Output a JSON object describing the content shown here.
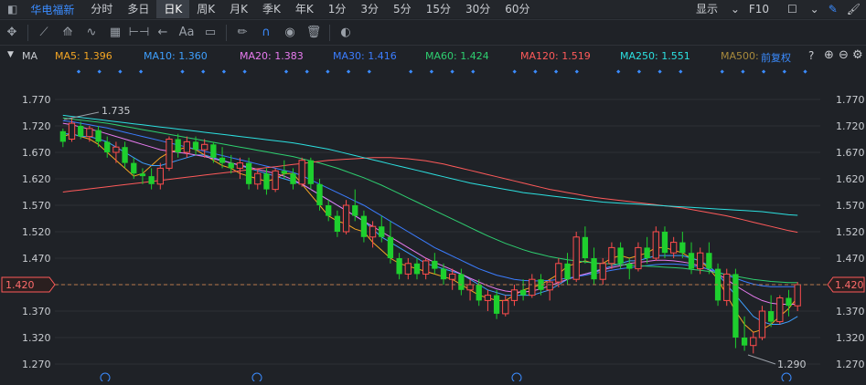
{
  "topbar": {
    "stock_name": "华电福新",
    "tabs": [
      {
        "label": "分时"
      },
      {
        "label": "多日"
      },
      {
        "label": "日K"
      },
      {
        "label": "周K"
      },
      {
        "label": "月K"
      },
      {
        "label": "季K"
      },
      {
        "label": "年K"
      },
      {
        "label": "1分"
      },
      {
        "label": "3分"
      },
      {
        "label": "5分"
      },
      {
        "label": "15分"
      },
      {
        "label": "30分"
      },
      {
        "label": "60分"
      }
    ],
    "active_tab": "日K",
    "display_label": "显示",
    "f10_label": "F10"
  },
  "toolbar": {
    "tools": [
      "crosshair-icon",
      "line-icon",
      "pencil-line-icon",
      "wave-icon",
      "grid-icon",
      "measure-icon",
      "arrow-left-icon",
      "text-icon",
      "comment-icon",
      "eraser-icon",
      "magnet-icon",
      "eye-icon",
      "trash-icon",
      "toggle-icon"
    ],
    "text_tool_label": "Aa"
  },
  "ma_bar": {
    "label": "MA",
    "items": [
      {
        "text": "MA5: 1.396",
        "color": "#f5a623"
      },
      {
        "text": "MA10: 1.360",
        "color": "#3ea0ff"
      },
      {
        "text": "MA20: 1.383",
        "color": "#e87bf0"
      },
      {
        "text": "MA30: 1.416",
        "color": "#3b7dff"
      },
      {
        "text": "MA60: 1.424",
        "color": "#2ecf70"
      },
      {
        "text": "MA120: 1.519",
        "color": "#ff5a5a"
      },
      {
        "text": "MA250: 1.551",
        "color": "#2ce0e0"
      },
      {
        "text": "MA500: ",
        "color": "#a88a3c"
      }
    ],
    "adjust_label": "前复权"
  },
  "chart_data": {
    "type": "candlestick",
    "y_ticks": [
      "1.770",
      "1.720",
      "1.670",
      "1.620",
      "1.570",
      "1.520",
      "1.470",
      "1.420",
      "1.370",
      "1.320",
      "1.270"
    ],
    "ylim": [
      1.255,
      1.795
    ],
    "current_price": "1.420",
    "high_label": "1.735",
    "low_label": "1.290",
    "colors": {
      "up": "#ff4d4d",
      "down": "#1ecf2e",
      "grid": "#2c3036",
      "dashed": "#b8794d"
    },
    "ohlc": [
      [
        1.71,
        1.715,
        1.68,
        1.69
      ],
      [
        1.695,
        1.735,
        1.69,
        1.725
      ],
      [
        1.72,
        1.728,
        1.695,
        1.7
      ],
      [
        1.7,
        1.72,
        1.69,
        1.715
      ],
      [
        1.712,
        1.72,
        1.68,
        1.69
      ],
      [
        1.69,
        1.7,
        1.66,
        1.67
      ],
      [
        1.67,
        1.69,
        1.65,
        1.68
      ],
      [
        1.68,
        1.69,
        1.64,
        1.65
      ],
      [
        1.65,
        1.66,
        1.62,
        1.63
      ],
      [
        1.63,
        1.64,
        1.61,
        1.625
      ],
      [
        1.625,
        1.64,
        1.6,
        1.61
      ],
      [
        1.61,
        1.65,
        1.6,
        1.64
      ],
      [
        1.64,
        1.7,
        1.635,
        1.695
      ],
      [
        1.695,
        1.705,
        1.66,
        1.67
      ],
      [
        1.67,
        1.7,
        1.66,
        1.69
      ],
      [
        1.69,
        1.7,
        1.665,
        1.675
      ],
      [
        1.675,
        1.695,
        1.66,
        1.685
      ],
      [
        1.685,
        1.69,
        1.65,
        1.66
      ],
      [
        1.66,
        1.68,
        1.64,
        1.65
      ],
      [
        1.65,
        1.665,
        1.63,
        1.64
      ],
      [
        1.64,
        1.66,
        1.62,
        1.65
      ],
      [
        1.65,
        1.66,
        1.6,
        1.61
      ],
      [
        1.61,
        1.64,
        1.6,
        1.63
      ],
      [
        1.63,
        1.64,
        1.59,
        1.6
      ],
      [
        1.6,
        1.64,
        1.595,
        1.635
      ],
      [
        1.635,
        1.655,
        1.62,
        1.63
      ],
      [
        1.63,
        1.64,
        1.6,
        1.61
      ],
      [
        1.61,
        1.66,
        1.605,
        1.655
      ],
      [
        1.655,
        1.66,
        1.6,
        1.61
      ],
      [
        1.61,
        1.62,
        1.56,
        1.57
      ],
      [
        1.57,
        1.58,
        1.54,
        1.55
      ],
      [
        1.55,
        1.56,
        1.51,
        1.52
      ],
      [
        1.52,
        1.58,
        1.515,
        1.57
      ],
      [
        1.57,
        1.6,
        1.54,
        1.55
      ],
      [
        1.55,
        1.56,
        1.5,
        1.51
      ],
      [
        1.51,
        1.54,
        1.49,
        1.53
      ],
      [
        1.53,
        1.55,
        1.5,
        1.51
      ],
      [
        1.51,
        1.54,
        1.46,
        1.47
      ],
      [
        1.47,
        1.48,
        1.43,
        1.44
      ],
      [
        1.44,
        1.47,
        1.43,
        1.46
      ],
      [
        1.46,
        1.47,
        1.43,
        1.44
      ],
      [
        1.44,
        1.47,
        1.43,
        1.465
      ],
      [
        1.465,
        1.48,
        1.44,
        1.45
      ],
      [
        1.45,
        1.46,
        1.42,
        1.43
      ],
      [
        1.43,
        1.45,
        1.41,
        1.44
      ],
      [
        1.44,
        1.45,
        1.4,
        1.41
      ],
      [
        1.41,
        1.43,
        1.39,
        1.42
      ],
      [
        1.42,
        1.43,
        1.38,
        1.39
      ],
      [
        1.39,
        1.41,
        1.37,
        1.4
      ],
      [
        1.4,
        1.41,
        1.355,
        1.365
      ],
      [
        1.365,
        1.4,
        1.36,
        1.39
      ],
      [
        1.39,
        1.42,
        1.38,
        1.41
      ],
      [
        1.41,
        1.43,
        1.39,
        1.4
      ],
      [
        1.4,
        1.44,
        1.395,
        1.43
      ],
      [
        1.43,
        1.44,
        1.4,
        1.41
      ],
      [
        1.41,
        1.43,
        1.39,
        1.425
      ],
      [
        1.425,
        1.47,
        1.415,
        1.46
      ],
      [
        1.46,
        1.48,
        1.42,
        1.43
      ],
      [
        1.43,
        1.52,
        1.425,
        1.51
      ],
      [
        1.51,
        1.53,
        1.46,
        1.47
      ],
      [
        1.47,
        1.49,
        1.42,
        1.43
      ],
      [
        1.43,
        1.47,
        1.42,
        1.46
      ],
      [
        1.46,
        1.5,
        1.45,
        1.49
      ],
      [
        1.49,
        1.5,
        1.45,
        1.46
      ],
      [
        1.46,
        1.47,
        1.43,
        1.45
      ],
      [
        1.45,
        1.5,
        1.445,
        1.49
      ],
      [
        1.49,
        1.51,
        1.46,
        1.47
      ],
      [
        1.47,
        1.53,
        1.465,
        1.52
      ],
      [
        1.52,
        1.53,
        1.47,
        1.48
      ],
      [
        1.48,
        1.51,
        1.47,
        1.5
      ],
      [
        1.5,
        1.52,
        1.47,
        1.48
      ],
      [
        1.48,
        1.5,
        1.44,
        1.45
      ],
      [
        1.45,
        1.49,
        1.44,
        1.48
      ],
      [
        1.48,
        1.5,
        1.44,
        1.45
      ],
      [
        1.45,
        1.46,
        1.38,
        1.39
      ],
      [
        1.39,
        1.45,
        1.38,
        1.44
      ],
      [
        1.44,
        1.45,
        1.3,
        1.32
      ],
      [
        1.32,
        1.36,
        1.295,
        1.305
      ],
      [
        1.305,
        1.33,
        1.29,
        1.32
      ],
      [
        1.32,
        1.38,
        1.315,
        1.37
      ],
      [
        1.37,
        1.4,
        1.34,
        1.35
      ],
      [
        1.35,
        1.4,
        1.345,
        1.395
      ],
      [
        1.395,
        1.41,
        1.36,
        1.38
      ],
      [
        1.38,
        1.425,
        1.37,
        1.42
      ]
    ],
    "ma_series": [
      {
        "name": "MA5",
        "color": "#f5a623",
        "values": [
          1.7,
          1.705,
          1.7,
          1.695,
          1.685,
          1.67,
          1.655,
          1.64,
          1.625,
          1.63,
          1.645,
          1.66,
          1.67,
          1.675,
          1.68,
          1.675,
          1.665,
          1.655,
          1.645,
          1.64,
          1.63,
          1.625,
          1.62,
          1.615,
          1.62,
          1.63,
          1.63,
          1.61,
          1.59,
          1.57,
          1.55,
          1.54,
          1.535,
          1.525,
          1.52,
          1.5,
          1.485,
          1.47,
          1.46,
          1.455,
          1.45,
          1.445,
          1.44,
          1.435,
          1.43,
          1.42,
          1.41,
          1.4,
          1.395,
          1.39,
          1.39,
          1.4,
          1.41,
          1.415,
          1.42,
          1.43,
          1.44,
          1.455,
          1.46,
          1.465,
          1.46,
          1.46,
          1.47,
          1.475,
          1.47,
          1.475,
          1.48,
          1.49,
          1.49,
          1.485,
          1.48,
          1.47,
          1.465,
          1.45,
          1.43,
          1.4,
          1.37,
          1.345,
          1.33,
          1.335,
          1.345,
          1.36,
          1.375,
          1.396
        ]
      },
      {
        "name": "MA10",
        "color": "#3ea0ff",
        "values": [
          1.705,
          1.705,
          1.7,
          1.7,
          1.695,
          1.69,
          1.68,
          1.67,
          1.66,
          1.65,
          1.645,
          1.645,
          1.65,
          1.655,
          1.66,
          1.665,
          1.665,
          1.66,
          1.655,
          1.65,
          1.645,
          1.64,
          1.635,
          1.63,
          1.625,
          1.62,
          1.615,
          1.61,
          1.6,
          1.59,
          1.58,
          1.57,
          1.56,
          1.55,
          1.54,
          1.525,
          1.51,
          1.5,
          1.49,
          1.48,
          1.47,
          1.46,
          1.455,
          1.45,
          1.445,
          1.44,
          1.43,
          1.42,
          1.41,
          1.405,
          1.4,
          1.4,
          1.4,
          1.4,
          1.405,
          1.41,
          1.42,
          1.43,
          1.435,
          1.44,
          1.445,
          1.45,
          1.455,
          1.46,
          1.465,
          1.465,
          1.47,
          1.475,
          1.475,
          1.475,
          1.475,
          1.47,
          1.465,
          1.455,
          1.44,
          1.42,
          1.4,
          1.38,
          1.36,
          1.35,
          1.345,
          1.345,
          1.35,
          1.36
        ]
      },
      {
        "name": "MA20",
        "color": "#e87bf0",
        "values": [
          1.725,
          1.722,
          1.718,
          1.714,
          1.71,
          1.705,
          1.7,
          1.695,
          1.69,
          1.685,
          1.68,
          1.675,
          1.672,
          1.67,
          1.668,
          1.665,
          1.662,
          1.658,
          1.654,
          1.65,
          1.646,
          1.642,
          1.638,
          1.634,
          1.63,
          1.625,
          1.618,
          1.61,
          1.6,
          1.59,
          1.58,
          1.57,
          1.56,
          1.55,
          1.54,
          1.53,
          1.52,
          1.51,
          1.5,
          1.49,
          1.48,
          1.47,
          1.462,
          1.455,
          1.448,
          1.44,
          1.432,
          1.425,
          1.418,
          1.412,
          1.408,
          1.406,
          1.406,
          1.408,
          1.412,
          1.418,
          1.424,
          1.43,
          1.436,
          1.44,
          1.444,
          1.448,
          1.452,
          1.456,
          1.46,
          1.462,
          1.464,
          1.466,
          1.466,
          1.465,
          1.463,
          1.46,
          1.455,
          1.448,
          1.44,
          1.43,
          1.418,
          1.408,
          1.398,
          1.39,
          1.385,
          1.383,
          1.383,
          1.383
        ]
      },
      {
        "name": "MA30",
        "color": "#3b7dff",
        "values": [
          1.73,
          1.728,
          1.725,
          1.722,
          1.719,
          1.716,
          1.712,
          1.708,
          1.704,
          1.7,
          1.696,
          1.692,
          1.688,
          1.684,
          1.68,
          1.676,
          1.672,
          1.668,
          1.664,
          1.66,
          1.656,
          1.652,
          1.648,
          1.644,
          1.64,
          1.636,
          1.632,
          1.626,
          1.618,
          1.61,
          1.602,
          1.594,
          1.586,
          1.578,
          1.57,
          1.56,
          1.55,
          1.54,
          1.53,
          1.52,
          1.51,
          1.5,
          1.49,
          1.482,
          1.474,
          1.466,
          1.458,
          1.45,
          1.444,
          1.438,
          1.434,
          1.43,
          1.428,
          1.427,
          1.427,
          1.428,
          1.43,
          1.432,
          1.435,
          1.438,
          1.441,
          1.444,
          1.447,
          1.45,
          1.452,
          1.454,
          1.456,
          1.458,
          1.459,
          1.459,
          1.458,
          1.456,
          1.453,
          1.449,
          1.444,
          1.438,
          1.432,
          1.426,
          1.421,
          1.418,
          1.416,
          1.416,
          1.416,
          1.416
        ]
      },
      {
        "name": "MA60",
        "color": "#2ecf70",
        "values": [
          1.735,
          1.733,
          1.731,
          1.729,
          1.727,
          1.725,
          1.722,
          1.719,
          1.716,
          1.713,
          1.71,
          1.707,
          1.704,
          1.701,
          1.698,
          1.695,
          1.692,
          1.689,
          1.686,
          1.683,
          1.68,
          1.677,
          1.674,
          1.671,
          1.668,
          1.665,
          1.662,
          1.658,
          1.654,
          1.65,
          1.645,
          1.64,
          1.634,
          1.628,
          1.622,
          1.615,
          1.608,
          1.6,
          1.592,
          1.584,
          1.576,
          1.568,
          1.56,
          1.552,
          1.544,
          1.536,
          1.528,
          1.52,
          1.512,
          1.505,
          1.498,
          1.492,
          1.486,
          1.481,
          1.477,
          1.473,
          1.47,
          1.467,
          1.465,
          1.463,
          1.461,
          1.46,
          1.459,
          1.458,
          1.457,
          1.456,
          1.455,
          1.454,
          1.453,
          1.452,
          1.451,
          1.449,
          1.447,
          1.445,
          1.442,
          1.439,
          1.436,
          1.433,
          1.43,
          1.428,
          1.426,
          1.425,
          1.424,
          1.424
        ]
      },
      {
        "name": "MA120",
        "color": "#ff5a5a",
        "values": [
          1.595,
          1.597,
          1.599,
          1.601,
          1.603,
          1.605,
          1.607,
          1.609,
          1.611,
          1.613,
          1.615,
          1.617,
          1.619,
          1.621,
          1.623,
          1.625,
          1.627,
          1.629,
          1.631,
          1.633,
          1.635,
          1.637,
          1.639,
          1.641,
          1.643,
          1.645,
          1.647,
          1.649,
          1.651,
          1.653,
          1.655,
          1.656,
          1.657,
          1.658,
          1.659,
          1.66,
          1.66,
          1.66,
          1.659,
          1.658,
          1.656,
          1.654,
          1.651,
          1.648,
          1.644,
          1.64,
          1.636,
          1.632,
          1.628,
          1.624,
          1.62,
          1.616,
          1.612,
          1.608,
          1.604,
          1.6,
          1.597,
          1.594,
          1.591,
          1.588,
          1.585,
          1.583,
          1.581,
          1.579,
          1.577,
          1.575,
          1.573,
          1.571,
          1.569,
          1.567,
          1.565,
          1.562,
          1.559,
          1.556,
          1.553,
          1.55,
          1.546,
          1.542,
          1.538,
          1.534,
          1.53,
          1.526,
          1.522,
          1.519
        ]
      },
      {
        "name": "MA250",
        "color": "#2ce0e0",
        "values": [
          1.74,
          1.738,
          1.736,
          1.734,
          1.732,
          1.73,
          1.728,
          1.726,
          1.724,
          1.722,
          1.72,
          1.718,
          1.716,
          1.714,
          1.712,
          1.71,
          1.708,
          1.706,
          1.704,
          1.702,
          1.7,
          1.698,
          1.696,
          1.694,
          1.692,
          1.69,
          1.688,
          1.685,
          1.682,
          1.679,
          1.676,
          1.672,
          1.668,
          1.664,
          1.66,
          1.656,
          1.652,
          1.648,
          1.644,
          1.64,
          1.636,
          1.632,
          1.628,
          1.624,
          1.62,
          1.616,
          1.612,
          1.609,
          1.606,
          1.603,
          1.6,
          1.597,
          1.594,
          1.592,
          1.59,
          1.588,
          1.586,
          1.584,
          1.582,
          1.58,
          1.578,
          1.576,
          1.575,
          1.574,
          1.573,
          1.572,
          1.571,
          1.57,
          1.569,
          1.568,
          1.567,
          1.566,
          1.565,
          1.564,
          1.563,
          1.562,
          1.561,
          1.56,
          1.559,
          1.558,
          1.556,
          1.554,
          1.552,
          1.551
        ]
      }
    ]
  }
}
